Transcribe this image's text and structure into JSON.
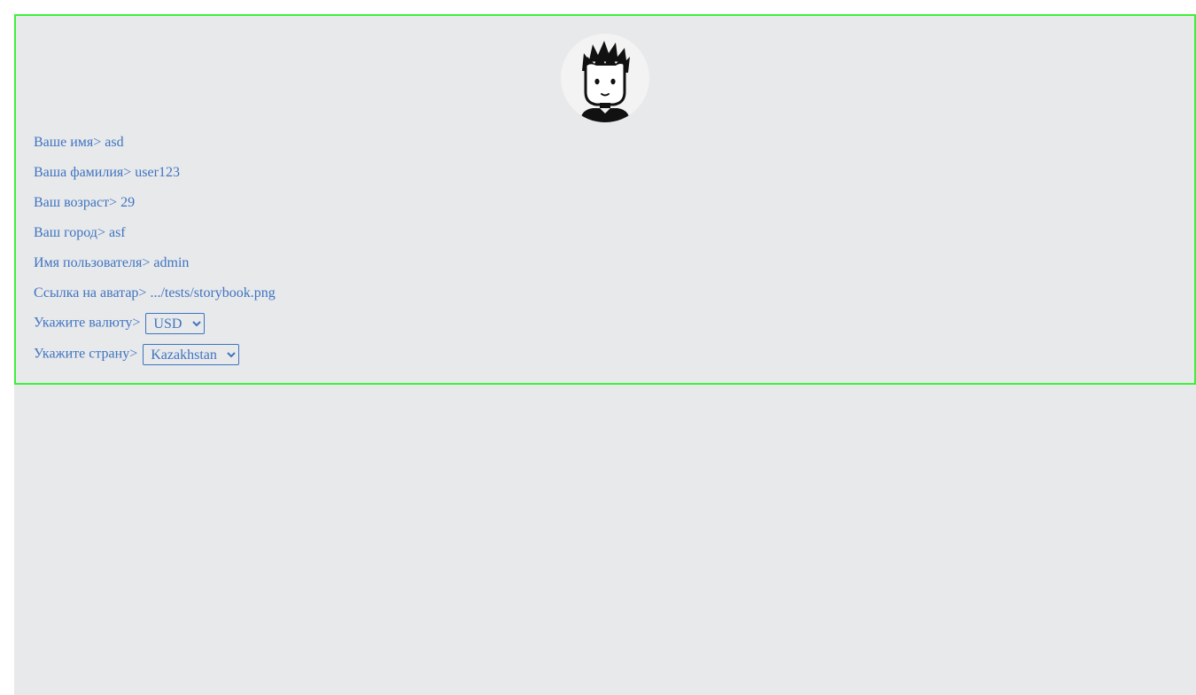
{
  "profile": {
    "avatar_icon": "cartoon-user-avatar",
    "fields": [
      {
        "label": "Ваше имя>",
        "value": "asd"
      },
      {
        "label": "Ваша фамилия>",
        "value": "user123"
      },
      {
        "label": "Ваш возраст>",
        "value": "29"
      },
      {
        "label": "Ваш город>",
        "value": "asf"
      },
      {
        "label": "Имя пользователя>",
        "value": "admin"
      },
      {
        "label": "Ссылка на аватар>",
        "value": ".../tests/storybook.png"
      }
    ],
    "currency": {
      "label": "Укажите валюту>",
      "selected": "USD"
    },
    "country": {
      "label": "Укажите страну>",
      "selected": "Kazakhstan"
    }
  },
  "colors": {
    "border": "#3ef03a",
    "text": "#3f74c0",
    "background": "#e8e9eb"
  }
}
